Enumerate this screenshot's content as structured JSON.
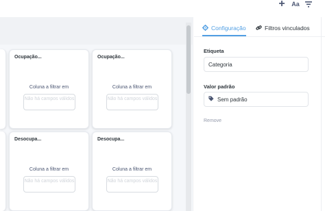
{
  "toolbar": {
    "add_icon": "plus-icon",
    "text_icon_label": "Aa",
    "filter_icon": "filter-lines-icon"
  },
  "cards": [
    {
      "title": "Ocupação...",
      "label": "Coluna a filtrar em",
      "box": "Não há campos válidos"
    },
    {
      "title": "Ocupação...",
      "label": "Coluna a filtrar em",
      "box": "Não há campos válidos"
    },
    {
      "title": "Desocupa...",
      "label": "Coluna a filtrar em",
      "box": "Não há campos válidos"
    },
    {
      "title": "Desocupa...",
      "label": "Coluna a filtrar em",
      "box": "Não há campos válidos"
    }
  ],
  "sidebar": {
    "tabs": [
      {
        "label": "Configuração",
        "icon": "gear-icon",
        "active": true
      },
      {
        "label": "Filtros vinculados",
        "icon": "link-icon",
        "active": false
      }
    ],
    "label_field": {
      "label": "Etiqueta",
      "value": "Categoria"
    },
    "default_field": {
      "label": "Valor padrão",
      "value": "Sem padrão",
      "icon": "tag-icon"
    },
    "remove_label": "Remove"
  },
  "colors": {
    "accent": "#509ee3",
    "text": "#2e353b",
    "muted": "#949aab"
  }
}
